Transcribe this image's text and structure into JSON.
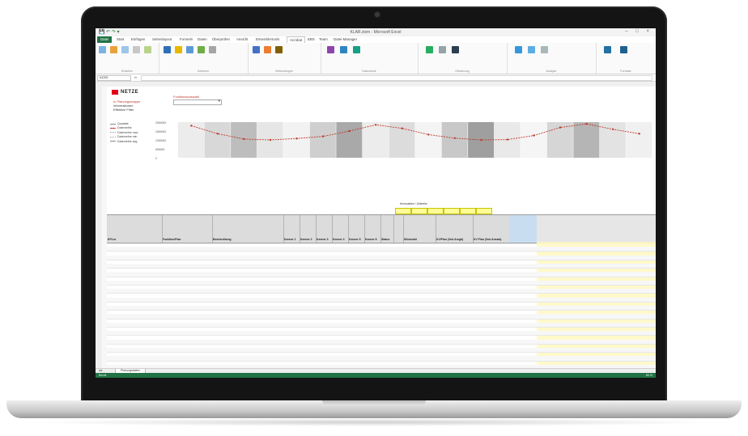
{
  "window": {
    "title": "KLAR.xlsm - Microsoft Excel",
    "controls": "– □ ×",
    "quick_access": "💾 ↶ ↷ ▾"
  },
  "ribbon_tabs": [
    "Datei",
    "Start",
    "Einfügen",
    "Seitenlayout",
    "Formeln",
    "Daten",
    "Überprüfen",
    "Ansicht",
    "Entwicklertools",
    "Acrobat",
    "EBS",
    "Team",
    "Datei-Manager"
  ],
  "ribbon_active_tab": "Acrobat",
  "ribbon_groups": [
    "Erstellen",
    "Sortieren",
    "Verbindungen",
    "Datentools",
    "Gliederung",
    "Analyse",
    "Formate"
  ],
  "formula_bar": {
    "name_box": "A1200",
    "fx": "fx"
  },
  "sheet": {
    "logo": "NETZE",
    "filters": [
      {
        "label": "In Planungsmappe",
        "value": "Funktionsauswahl"
      },
      {
        "label": "Informationen",
        "value": ""
      },
      {
        "label": "Effektive Filter",
        "value": ""
      }
    ],
    "legend": [
      "Quartale",
      "Datenreihe",
      "Datenreihe max",
      "Datenreihe min",
      "Datenreihe avg"
    ],
    "y_ticks": [
      "2000000",
      "1500000",
      "1000000",
      "500000",
      "0"
    ],
    "group_header": "Kennzahlen / Zeitreihe",
    "columns": [
      "KPLnr",
      "Funktion/Plan",
      "Beschreibung",
      "Kenner 1",
      "Kenner 2",
      "Kenner 3",
      "Kenner 4",
      "Kenner 5",
      "Kenner 6",
      "Status",
      "",
      "Stückzahl",
      "KV/Plan (Vorl.Anrgb)",
      "KV Plan (Vorl.Ansatz)"
    ],
    "sheet_tab": "Planungsdaten",
    "status": "Bereit",
    "zoom": "85 %"
  },
  "chart_data": {
    "type": "line",
    "title": "",
    "xlabel": "",
    "ylabel": "",
    "ylim": [
      0,
      2000000
    ],
    "x": [
      1,
      2,
      3,
      4,
      5,
      6,
      7,
      8,
      9,
      10,
      11,
      12,
      13,
      14,
      15,
      16,
      17,
      18
    ],
    "series": [
      {
        "name": "Datenreihe",
        "values": [
          1800000,
          1350000,
          1050000,
          1000000,
          1080000,
          1200000,
          1500000,
          1850000,
          1650000,
          1300000,
          1100000,
          1000000,
          1020000,
          1250000,
          1700000,
          1900000,
          1600000,
          1350000
        ]
      }
    ]
  },
  "colors": {
    "excel_green": "#217346",
    "red": "#c0392b",
    "yellow": "#fffb96"
  }
}
